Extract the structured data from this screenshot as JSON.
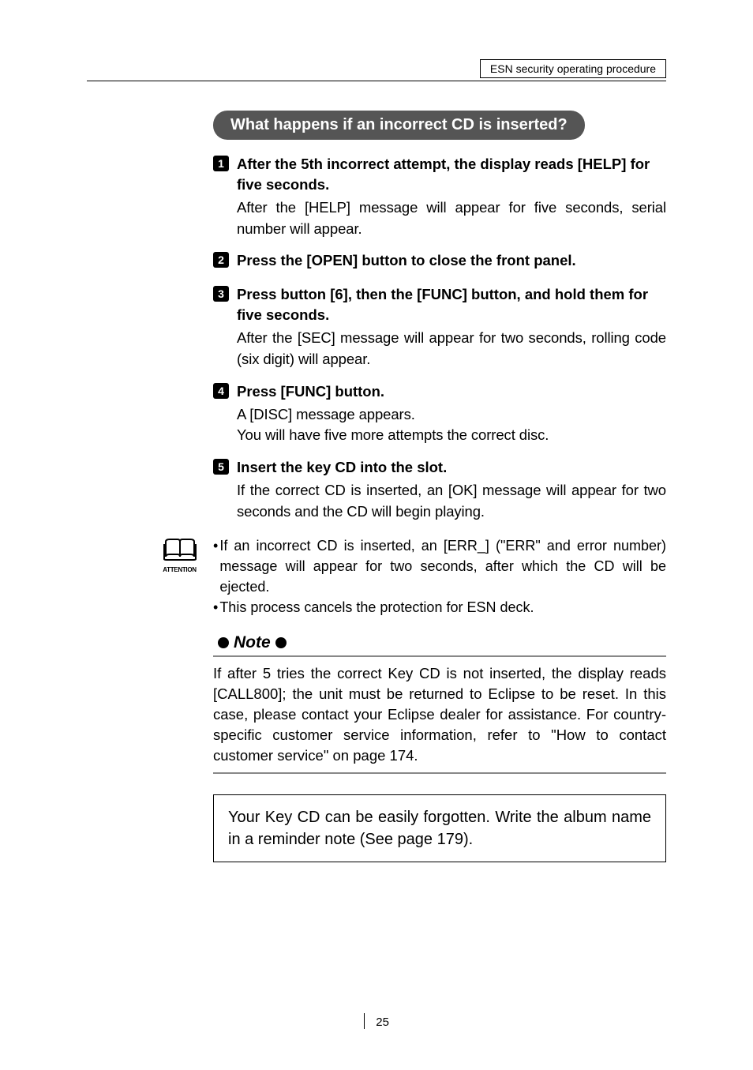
{
  "header": {
    "boxText": "ESN security operating procedure"
  },
  "title": "What happens if an incorrect CD is inserted?",
  "steps": [
    {
      "num": "1",
      "title": "After the 5th incorrect attempt, the display reads [HELP] for five seconds.",
      "desc": "After the [HELP] message will appear for five seconds, serial number will appear."
    },
    {
      "num": "2",
      "title": "Press the [OPEN] button to close the front panel.",
      "desc": ""
    },
    {
      "num": "3",
      "title": "Press button [6], then the [FUNC] button, and hold them for five seconds.",
      "desc": "After the [SEC] message will appear for two seconds, rolling code (six digit) will appear."
    },
    {
      "num": "4",
      "title": "Press [FUNC] button.",
      "desc": "A [DISC] message appears.\nYou will have five more attempts the correct disc."
    },
    {
      "num": "5",
      "title": "Insert the key CD into the slot.",
      "desc": "If the correct CD is inserted, an [OK] message will appear for two seconds and the CD will begin playing."
    }
  ],
  "attention": {
    "label": "ATTENTION",
    "bullets": [
      "If an incorrect CD is inserted, an [ERR_] (\"ERR\" and error number) message will appear for two seconds, after which the CD will be ejected.",
      "This process cancels the protection for ESN deck."
    ]
  },
  "note": {
    "label": "Note",
    "body": "If after 5 tries the correct Key CD is not inserted, the display reads [CALL800]; the unit must be returned to Eclipse to be reset. In this case, please contact your Eclipse dealer for assistance. For country-specific customer service information, refer to \"How to contact customer service\" on page 174."
  },
  "reminder": "Your Key CD can be easily forgotten. Write the album name in a reminder note (See page 179).",
  "pageNumber": "25"
}
